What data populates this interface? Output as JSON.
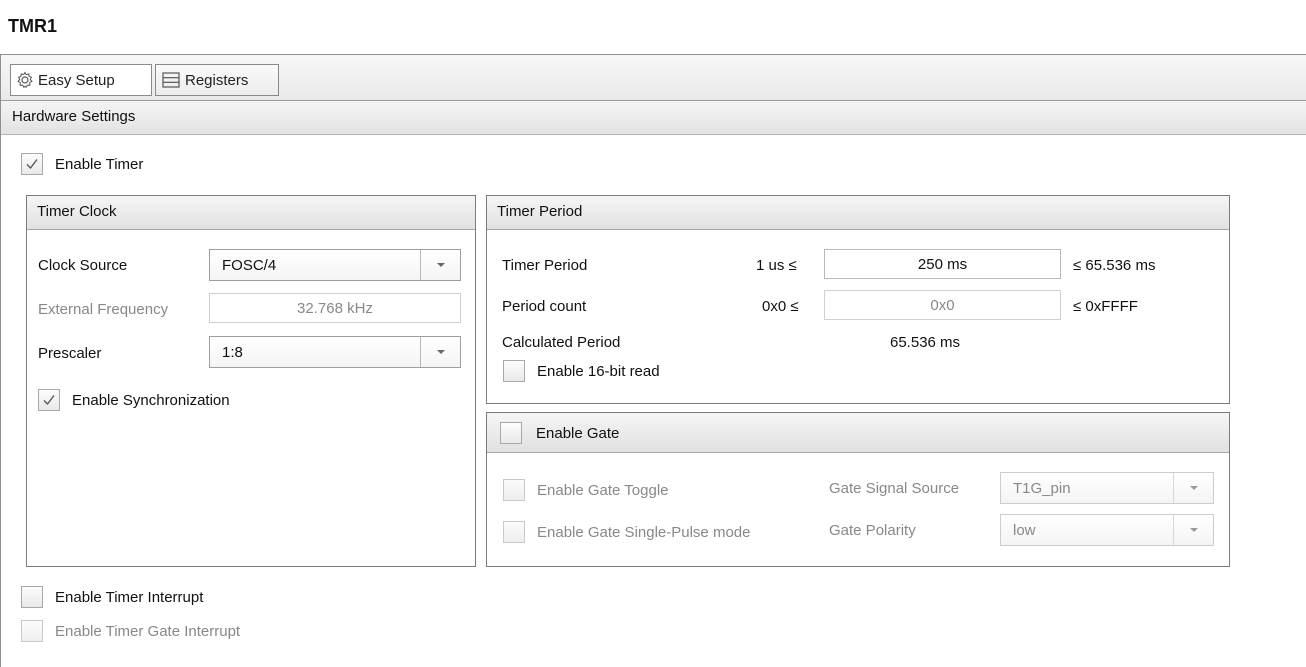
{
  "title": "TMR1",
  "tabs": [
    {
      "label": "Easy Setup",
      "icon": "gear-icon"
    },
    {
      "label": "Registers",
      "icon": "register-list-icon"
    }
  ],
  "section_header": "Hardware Settings",
  "enable_timer": {
    "label": "Enable Timer",
    "checked": true
  },
  "timer_clock": {
    "title": "Timer Clock",
    "clock_source_label": "Clock Source",
    "clock_source_value": "FOSC/4",
    "external_frequency_label": "External Frequency",
    "external_frequency_value": "32.768 kHz",
    "prescaler_label": "Prescaler",
    "prescaler_value": "1:8",
    "enable_sync_label": "Enable Synchronization",
    "enable_sync_checked": true
  },
  "timer_period": {
    "title": "Timer Period",
    "period_label": "Timer Period",
    "period_min": "1 us ≤",
    "period_value": "250 ms",
    "period_max": "≤ 65.536 ms",
    "count_label": "Period count",
    "count_min": "0x0 ≤",
    "count_value": "0x0",
    "count_max": "≤ 0xFFFF",
    "calculated_label": "Calculated Period",
    "calculated_value": "65.536 ms",
    "enable_16bit_label": "Enable 16-bit read",
    "enable_16bit_checked": false
  },
  "gate": {
    "title": "Enable Gate",
    "checked": false,
    "toggle_label": "Enable Gate Toggle",
    "single_pulse_label": "Enable Gate Single-Pulse mode",
    "signal_source_label": "Gate Signal Source",
    "signal_source_value": "T1G_pin",
    "polarity_label": "Gate Polarity",
    "polarity_value": "low"
  },
  "interrupts": {
    "timer_interrupt_label": "Enable Timer Interrupt",
    "gate_interrupt_label": "Enable Timer Gate Interrupt"
  },
  "colors": {
    "checkmark": "#555555",
    "disabled_text": "#888888",
    "panel_border": "#7b7b7b"
  }
}
